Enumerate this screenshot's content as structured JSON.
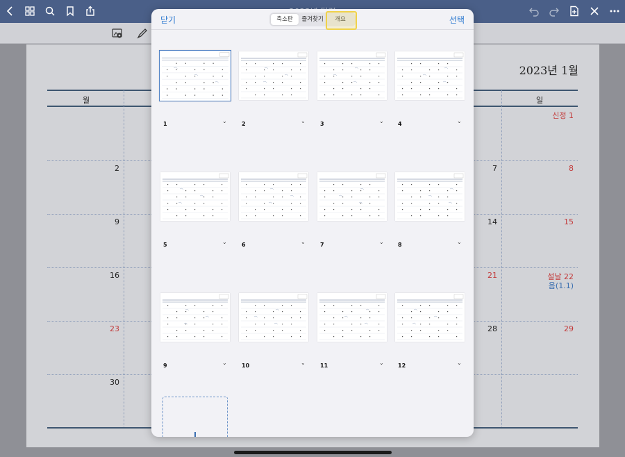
{
  "topbar": {
    "doc_title": "2023년 달력",
    "icons": [
      "back-chevron-icon",
      "grid-icon",
      "search-icon",
      "bookmark-icon",
      "share-icon",
      "undo-icon",
      "redo-icon",
      "add-page-icon",
      "close-icon",
      "more-icon"
    ]
  },
  "toolbar2": {
    "icons": [
      "lasso-image-icon",
      "pen-icon"
    ]
  },
  "document": {
    "month_title": "2023년 1월",
    "day_headers": {
      "mon": "월",
      "sun": "일"
    },
    "rows": [
      {
        "left": "",
        "mid": "",
        "right": "신정 1"
      },
      {
        "left": "2",
        "mid": "7",
        "right": "8"
      },
      {
        "left": "9",
        "mid": "14",
        "right": "15"
      },
      {
        "left": "16",
        "mid": "21",
        "right": "설날 22",
        "right2": "음(1.1)"
      },
      {
        "left": "23",
        "mid": "28",
        "right": "29"
      },
      {
        "left": "30",
        "mid": "",
        "right": ""
      }
    ]
  },
  "modal": {
    "close_label": "닫기",
    "select_label": "선택",
    "segments": [
      "축소판",
      "즐겨찾기",
      "개요"
    ],
    "active_segment": "축소판",
    "thumbnails": [
      {
        "label": "1"
      },
      {
        "label": "2"
      },
      {
        "label": "3"
      },
      {
        "label": "4"
      },
      {
        "label": "5"
      },
      {
        "label": "6"
      },
      {
        "label": "7"
      },
      {
        "label": "8"
      },
      {
        "label": "9"
      },
      {
        "label": "10"
      },
      {
        "label": "11"
      },
      {
        "label": "12"
      }
    ],
    "chevron": "⌄"
  },
  "colors": {
    "topbar": "#4a5f88",
    "accent_blue": "#2e7ad0",
    "highlight": "#f0d24a",
    "holiday_red": "#c33a3a"
  }
}
